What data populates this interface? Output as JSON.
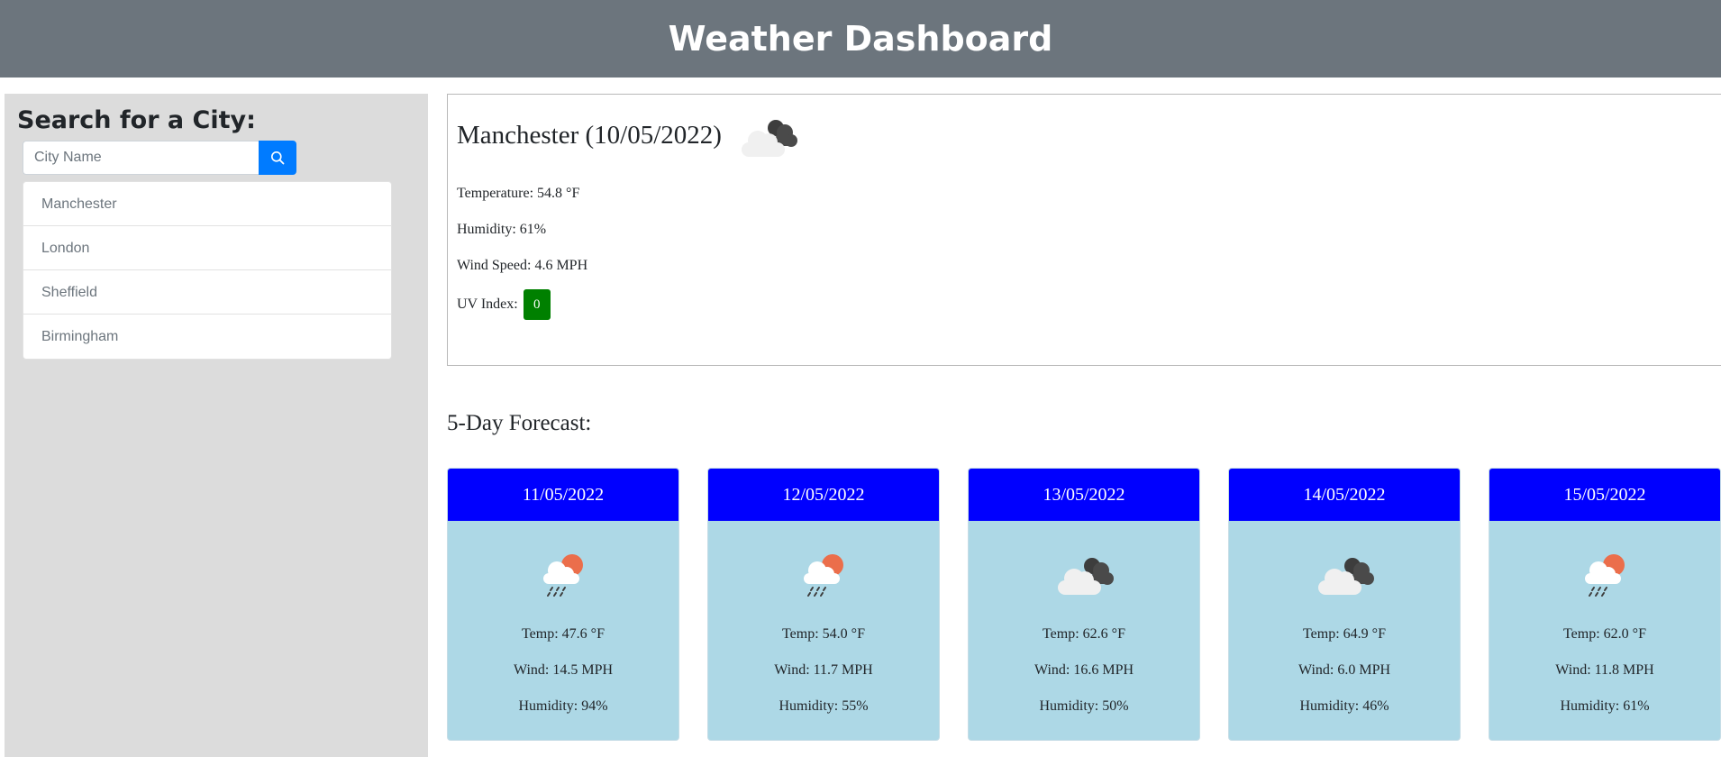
{
  "header": {
    "title": "Weather Dashboard"
  },
  "search": {
    "title": "Search for a City:",
    "placeholder": "City Name",
    "history": [
      "Manchester",
      "London",
      "Sheffield",
      "Birmingham"
    ]
  },
  "current": {
    "title": "Manchester (10/05/2022)",
    "icon": "broken-clouds-icon",
    "temperature": "Temperature: 54.8 °F",
    "humidity": "Humidity: 61%",
    "wind": "Wind Speed: 4.6 MPH",
    "uv_label": "UV Index:",
    "uv_value": "0",
    "uv_color": "#008000"
  },
  "forecast": {
    "title": "5-Day Forecast:",
    "days": [
      {
        "date": "11/05/2022",
        "icon": "rain-sun-icon",
        "temp": "Temp: 47.6 °F",
        "wind": "Wind: 14.5 MPH",
        "humidity": "Humidity: 94%"
      },
      {
        "date": "12/05/2022",
        "icon": "rain-sun-icon",
        "temp": "Temp: 54.0 °F",
        "wind": "Wind: 11.7 MPH",
        "humidity": "Humidity: 55%"
      },
      {
        "date": "13/05/2022",
        "icon": "broken-clouds-icon",
        "temp": "Temp: 62.6 °F",
        "wind": "Wind: 16.6 MPH",
        "humidity": "Humidity: 50%"
      },
      {
        "date": "14/05/2022",
        "icon": "broken-clouds-icon",
        "temp": "Temp: 64.9 °F",
        "wind": "Wind: 6.0 MPH",
        "humidity": "Humidity: 46%"
      },
      {
        "date": "15/05/2022",
        "icon": "rain-sun-icon",
        "temp": "Temp: 62.0 °F",
        "wind": "Wind: 11.8 MPH",
        "humidity": "Humidity: 61%"
      }
    ]
  },
  "colors": {
    "header_bg": "#6c757d",
    "search_button": "#007bff",
    "card_header": "#0000ff",
    "card_body": "#add8e6"
  }
}
